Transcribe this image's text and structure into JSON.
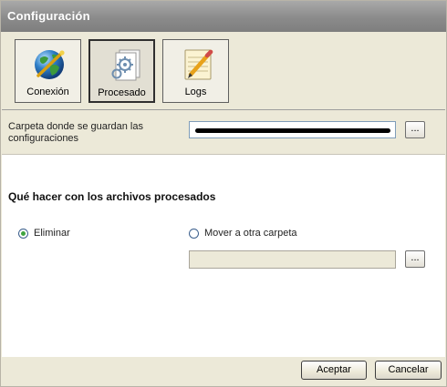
{
  "window": {
    "title": "Configuración"
  },
  "tabs": [
    {
      "label": "Conexión",
      "icon": "globe-icon",
      "selected": false
    },
    {
      "label": "Procesado",
      "icon": "gears-document-icon",
      "selected": true
    },
    {
      "label": "Logs",
      "icon": "notepad-pencil-icon",
      "selected": false
    }
  ],
  "config_folder": {
    "label": "Carpeta donde se guardan las configuraciones",
    "browse_label": "..."
  },
  "processed_files": {
    "heading": "Qué hacer con los archivos procesados",
    "option_delete": {
      "label": "Eliminar",
      "selected": true
    },
    "option_move": {
      "label": "Mover a otra carpeta",
      "selected": false
    },
    "browse_label": "..."
  },
  "buttons": {
    "accept": "Aceptar",
    "cancel": "Cancelar"
  },
  "colors": {
    "titlebar": "#8b8b8b",
    "window_bg": "#ece9d8",
    "radio_dot": "#3fa43f",
    "input_border": "#7f9db9"
  }
}
